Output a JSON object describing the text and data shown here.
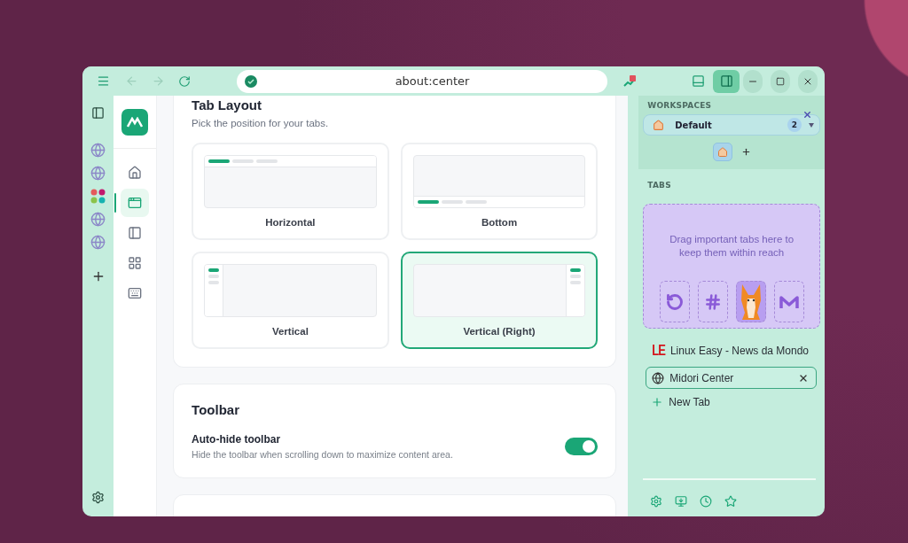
{
  "toolbar": {
    "address": "about:center"
  },
  "settings_nav": [
    {
      "selected": false
    },
    {
      "selected": true
    },
    {
      "selected": false
    },
    {
      "selected": false
    },
    {
      "selected": false
    }
  ],
  "tab_layout": {
    "title": "Tab Layout",
    "subtitle": "Pick the position for your tabs.",
    "options": [
      {
        "label": "Horizontal",
        "kind": "top",
        "selected": false
      },
      {
        "label": "Bottom",
        "kind": "bottom",
        "selected": false
      },
      {
        "label": "Vertical",
        "kind": "left",
        "selected": false
      },
      {
        "label": "Vertical (Right)",
        "kind": "right",
        "selected": true
      }
    ]
  },
  "toolbar_section": {
    "title": "Toolbar",
    "settings": [
      {
        "label": "Auto-hide toolbar",
        "description": "Hide the toolbar when scrolling down to maximize content area.",
        "on": true
      }
    ]
  },
  "sidebar": {
    "workspaces_header": "WORKSPACES",
    "workspace": {
      "name": "Default",
      "count": "2"
    },
    "tabs_header": "TABS",
    "pinned_hint": "Drag important tabs here to keep them within reach",
    "tabs": [
      {
        "kind": "text-favicon",
        "favicon": "LE",
        "title": "Linux Easy - News da Mondo",
        "selected": false
      },
      {
        "kind": "globe",
        "title": "Midori Center",
        "selected": true
      }
    ],
    "new_tab": "New Tab"
  }
}
